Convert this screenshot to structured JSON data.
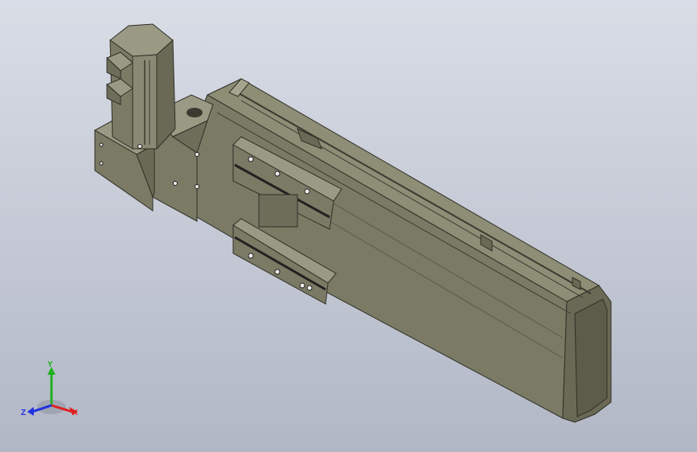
{
  "viewport": {
    "background_top": "#d9dde6",
    "background_bottom": "#b1b7c5",
    "model_color": "#7b7a65",
    "model_dark": "#4a4a3e",
    "model_light": "#9a9a84"
  },
  "triad": {
    "x_label": "X",
    "y_label": "Y",
    "z_label": "Z",
    "x_color": "#e02020",
    "y_color": "#20b020",
    "z_color": "#2030e0"
  }
}
